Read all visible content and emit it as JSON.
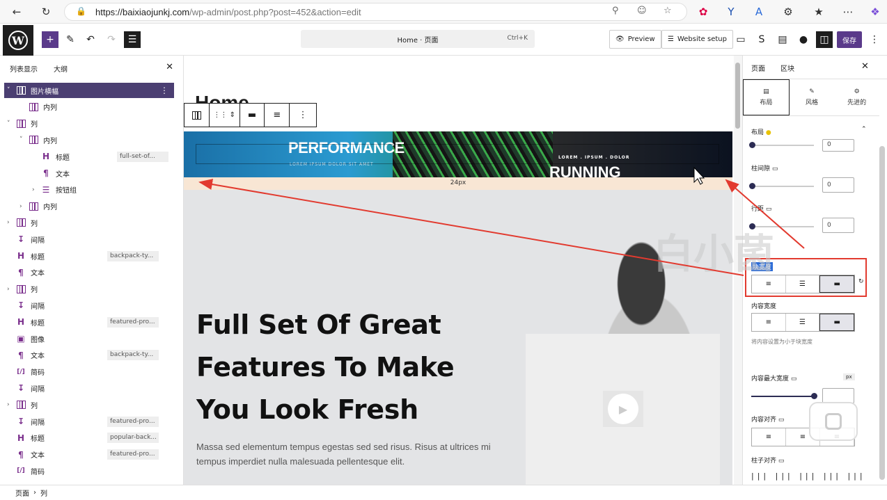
{
  "browser": {
    "url_host": "https://baixiaojunkj.com",
    "url_path": "/wp-admin/post.php?post=452&action=edit"
  },
  "wp_toolbar": {
    "document_title": "Home · 页面",
    "shortcut": "Ctrl+K",
    "preview_label": "Preview",
    "website_setup_label": "Website setup",
    "save_label": "保存"
  },
  "list_view": {
    "tab_list": "列表显示",
    "tab_outline": "大纲",
    "items": [
      {
        "label": "图片横幅",
        "icon": "columns",
        "depth": 0,
        "caret": "v",
        "selected": true
      },
      {
        "label": "内列",
        "icon": "column",
        "depth": 1,
        "caret": ""
      },
      {
        "label": "列",
        "icon": "columns",
        "depth": 0,
        "caret": "v"
      },
      {
        "label": "内列",
        "icon": "column",
        "depth": 1,
        "caret": "v"
      },
      {
        "label": "标题",
        "icon": "H",
        "depth": 2,
        "caret": "",
        "anchor": "full-set-of..."
      },
      {
        "label": "文本",
        "icon": "¶",
        "depth": 2,
        "caret": ""
      },
      {
        "label": "按钮组",
        "icon": "buttons",
        "depth": 2,
        "caret": ">"
      },
      {
        "label": "内列",
        "icon": "column",
        "depth": 1,
        "caret": ">"
      },
      {
        "label": "列",
        "icon": "columns",
        "depth": 0,
        "caret": ">"
      },
      {
        "label": "间隔",
        "icon": "spacer",
        "depth": 0,
        "caret": ""
      },
      {
        "label": "标题",
        "icon": "H",
        "depth": 0,
        "caret": "",
        "anchor": "backpack-ty..."
      },
      {
        "label": "文本",
        "icon": "¶",
        "depth": 0,
        "caret": ""
      },
      {
        "label": "列",
        "icon": "columns",
        "depth": 0,
        "caret": ">"
      },
      {
        "label": "间隔",
        "icon": "spacer",
        "depth": 0,
        "caret": ""
      },
      {
        "label": "标题",
        "icon": "H",
        "depth": 0,
        "caret": "",
        "anchor": "featured-pro..."
      },
      {
        "label": "图像",
        "icon": "image",
        "depth": 0,
        "caret": ""
      },
      {
        "label": "文本",
        "icon": "¶",
        "depth": 0,
        "caret": "",
        "anchor": "backpack-ty..."
      },
      {
        "label": "简码",
        "icon": "[/]",
        "depth": 0,
        "caret": ""
      },
      {
        "label": "间隔",
        "icon": "spacer",
        "depth": 0,
        "caret": ""
      },
      {
        "label": "列",
        "icon": "columns",
        "depth": 0,
        "caret": ">"
      },
      {
        "label": "间隔",
        "icon": "spacer",
        "depth": 0,
        "caret": "",
        "anchor": "featured-pro..."
      },
      {
        "label": "标题",
        "icon": "H",
        "depth": 0,
        "caret": "",
        "anchor": "popular-back..."
      },
      {
        "label": "文本",
        "icon": "¶",
        "depth": 0,
        "caret": "",
        "anchor": "featured-pro..."
      },
      {
        "label": "简码",
        "icon": "[/]",
        "depth": 0,
        "caret": ""
      }
    ]
  },
  "canvas": {
    "page_title": "Home",
    "banner_title": "PERFORMANCE",
    "banner_sub": "LOREM IPSUM DOLOR SIT AMET",
    "banner_right_small": "LOREM . IPSUM . DOLOR",
    "banner_right_big": "RUNNING",
    "spacer_label": "24px",
    "heading": "Full Set Of Great Features To Make You Look Fresh",
    "paragraph": "Massa sed elementum tempus egestas sed sed risus. Risus at ultrices mi tempus imperdiet nulla malesuada pellentesque elit."
  },
  "settings": {
    "tab_page": "页面",
    "tab_block": "区块",
    "subtab_layout": "布局",
    "subtab_style": "风格",
    "subtab_advanced": "先进的",
    "section_layout": "布局",
    "row_gap_value": "0",
    "column_gap_label": "柱间隙",
    "column_gap_value": "0",
    "row_spacing_label": "行距",
    "row_spacing_value": "0",
    "block_width_label": "块宽度",
    "content_width_label": "内容宽度",
    "content_width_hint": "将内容设置为小于块宽度",
    "content_max_width_label": "内容最大宽度",
    "content_max_width_unit": "px",
    "content_align_label": "内容对齐",
    "column_align_label": "柱子对齐"
  },
  "status_bar": {
    "crumb_1": "页面",
    "crumb_2": "列"
  },
  "watermark": "白小菌",
  "colors": {
    "accent": "#5a3a8a",
    "annotation_red": "#e23a2f",
    "selected_row": "#4b3f72"
  }
}
